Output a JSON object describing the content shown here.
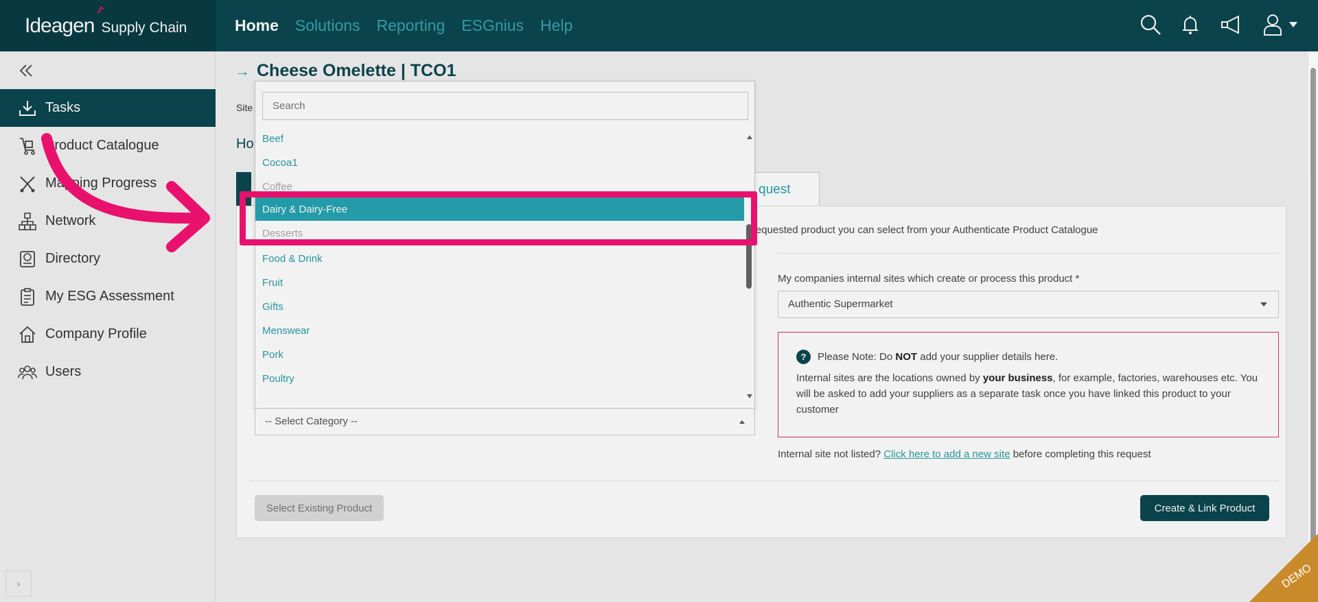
{
  "brand": {
    "logo": "Ideagen",
    "product": "Supply Chain"
  },
  "topnav": [
    {
      "label": "Home",
      "active": true
    },
    {
      "label": "Solutions"
    },
    {
      "label": "Reporting"
    },
    {
      "label": "ESGnius"
    },
    {
      "label": "Help"
    }
  ],
  "top_icons": [
    "search-icon",
    "bell-icon",
    "megaphone-icon",
    "user-icon"
  ],
  "sidebar": {
    "items": [
      {
        "label": "Tasks",
        "icon": "download-tray-icon",
        "active": true
      },
      {
        "label": "Product Catalogue",
        "icon": "trolley-icon"
      },
      {
        "label": "Mapping Progress",
        "icon": "mapping-icon"
      },
      {
        "label": "Network",
        "icon": "network-icon"
      },
      {
        "label": "Directory",
        "icon": "directory-icon"
      },
      {
        "label": "My ESG Assessment",
        "icon": "clipboard-icon"
      },
      {
        "label": "Company Profile",
        "icon": "house-icon"
      },
      {
        "label": "Users",
        "icon": "users-icon"
      }
    ],
    "expand_label": "›"
  },
  "page": {
    "title": "Cheese Omelette | TCO1",
    "site_stub": "Site",
    "heading_stub": "Ho",
    "request_tab": "quest"
  },
  "panel": {
    "info_line": "y created the requested product you can select from your Authenticate Product Catalogue",
    "sites_label": "My companies internal sites which create or process this product *",
    "sites_value": "Authentic Supermarket",
    "note_head_prefix": "Please Note: Do ",
    "note_head_bold": "NOT",
    "note_head_suffix": " add your supplier details here.",
    "note_body_1": "Internal sites are the locations owned by ",
    "note_body_bold": "your business",
    "note_body_2": ", for example, factories, warehouses etc. You will be asked to add your suppliers as a separate task once you have linked this product to your customer",
    "not_listed_prefix": "Internal site not listed? ",
    "not_listed_link": "Click here to add a new site",
    "not_listed_suffix": " before completing this request",
    "select_existing": "Select Existing Product",
    "create_link": "Create & Link Product"
  },
  "dropdown": {
    "search_placeholder": "Search",
    "items": [
      "Beef",
      "Cocoa1",
      "Coffee",
      "Dairy & Dairy-Free",
      "Desserts",
      "Food & Drink",
      "Fruit",
      "Gifts",
      "Menswear",
      "Pork",
      "Poultry"
    ],
    "selected": "Dairy & Dairy-Free",
    "category_placeholder": "-- Select Category --"
  },
  "demo_label": "DEMO",
  "colors": {
    "primary": "#0b4750",
    "accent": "#25a4b2",
    "highlight": "#e8116d"
  }
}
